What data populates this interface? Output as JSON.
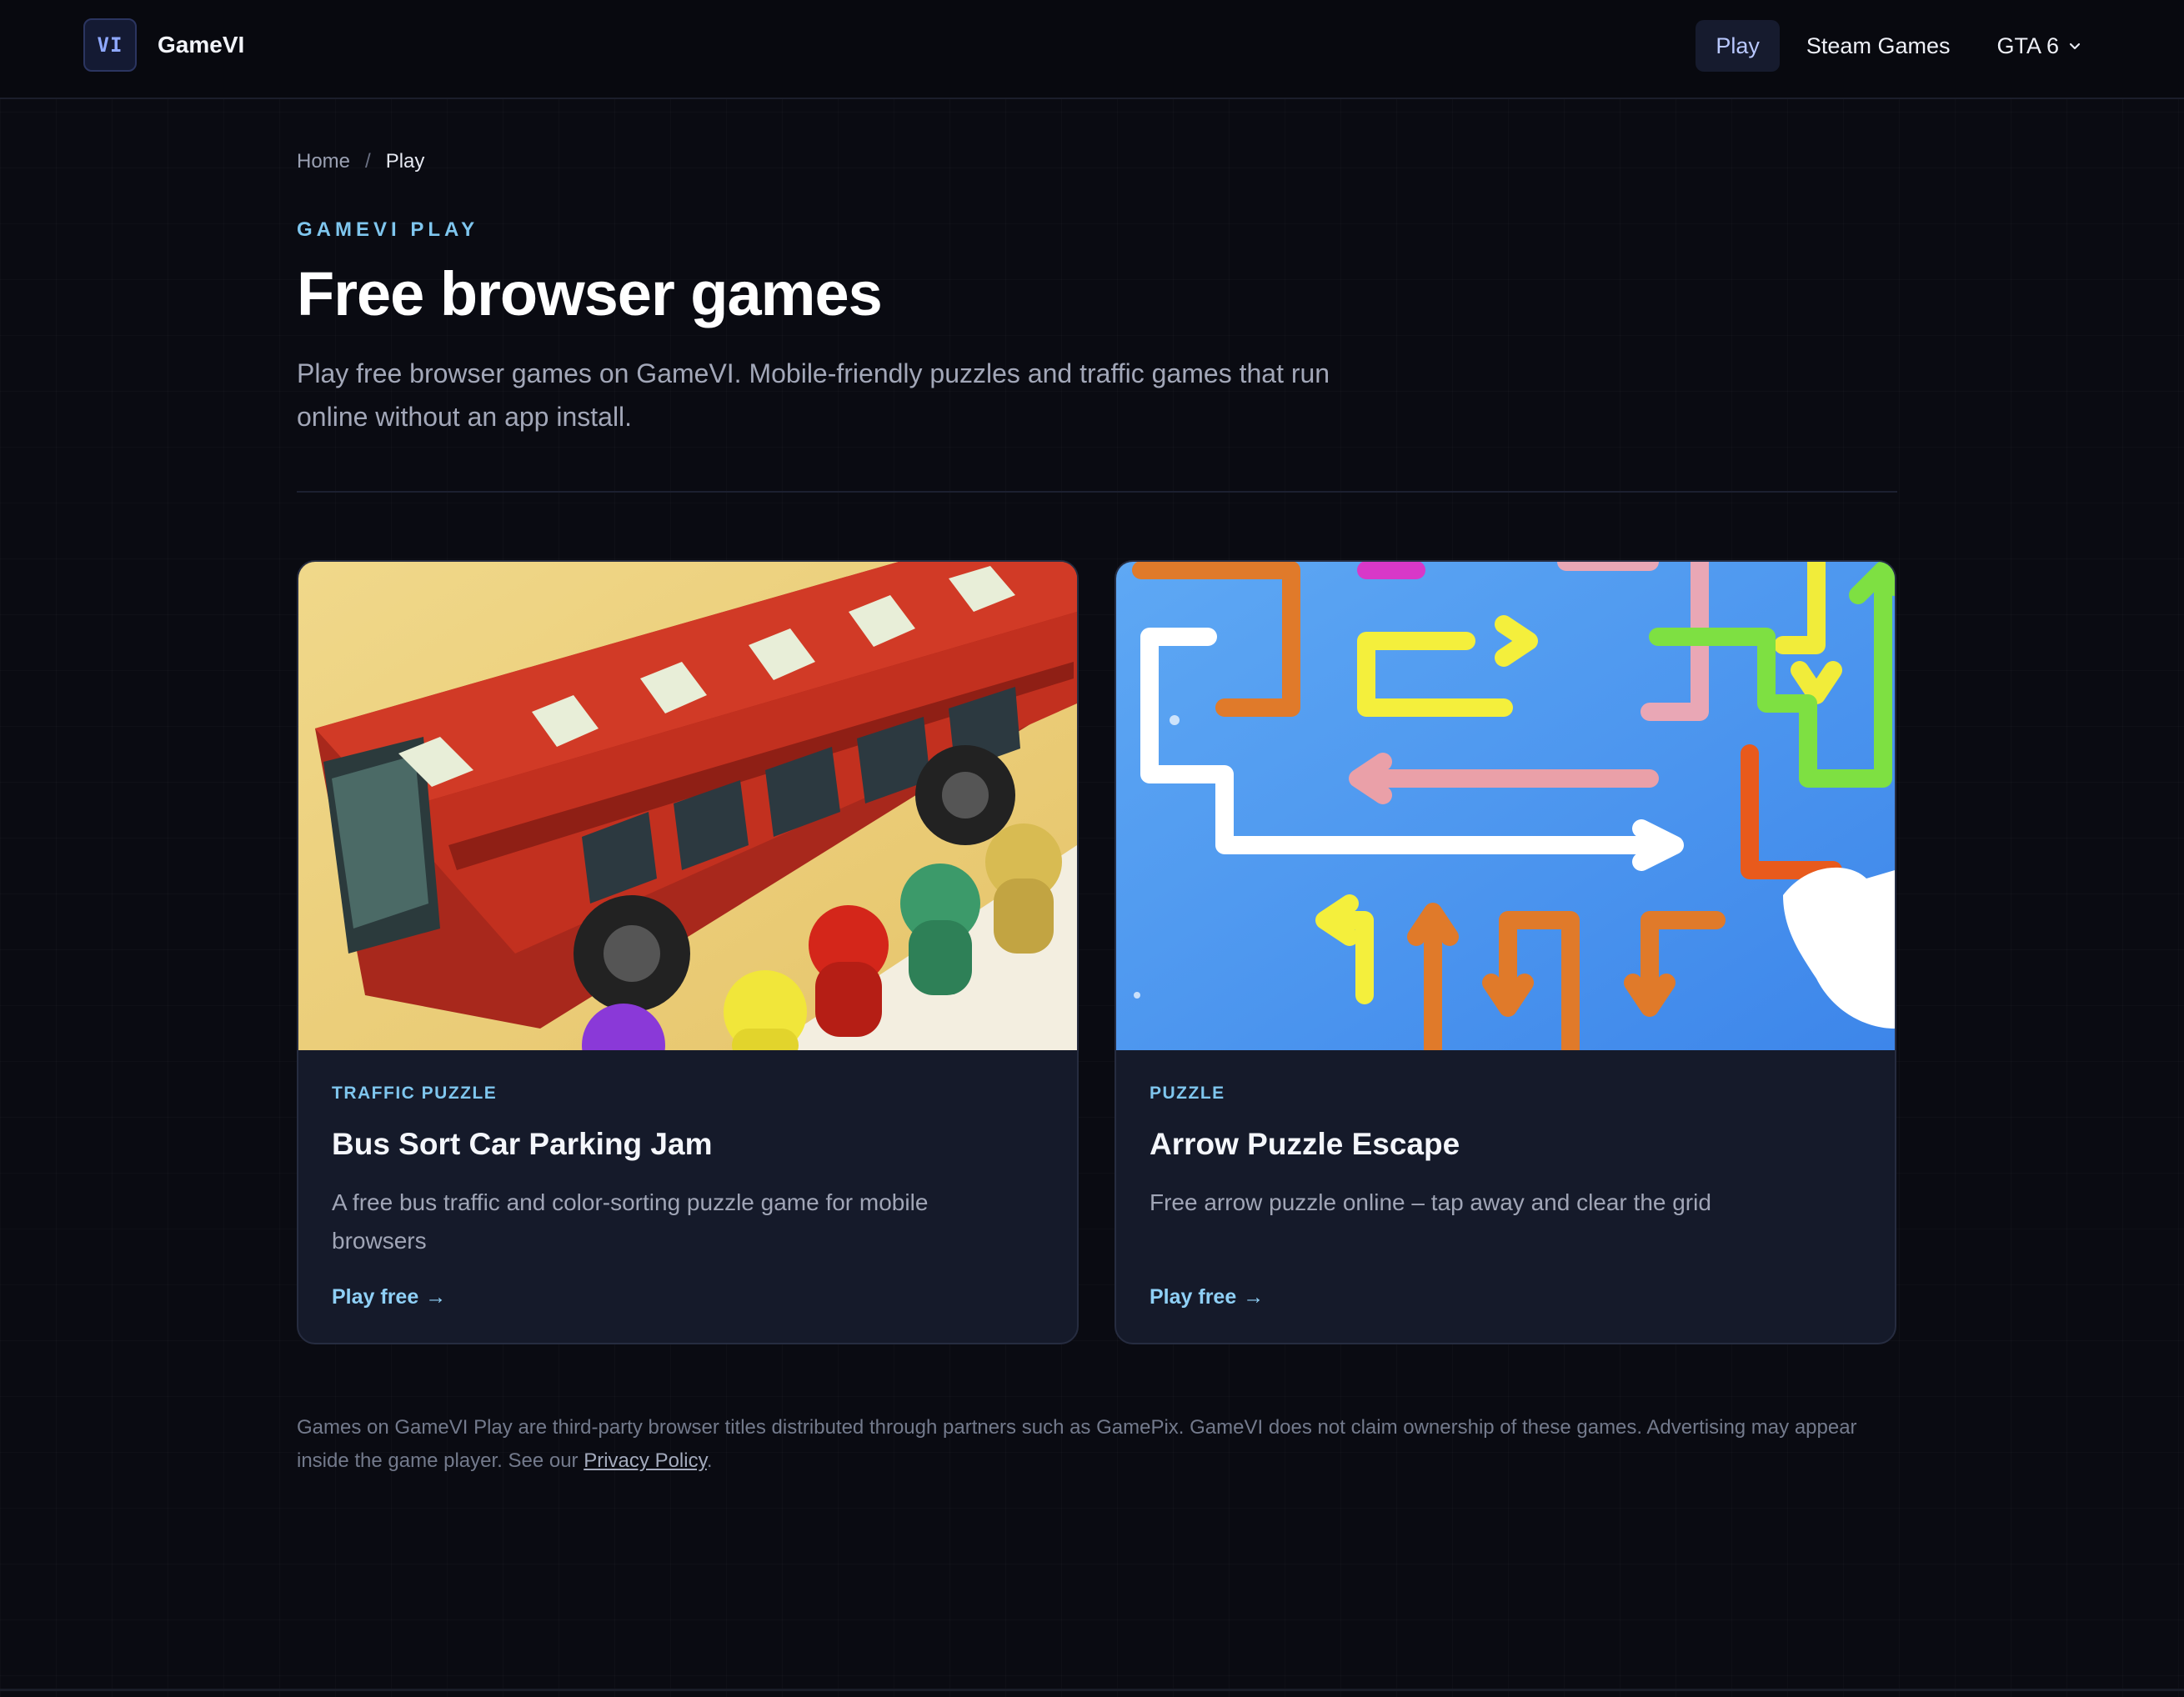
{
  "header": {
    "logo_text": "VI",
    "brand": "GameVI",
    "nav": [
      {
        "label": "Play",
        "active": true
      },
      {
        "label": "Steam Games",
        "active": false
      },
      {
        "label": "GTA 6",
        "active": false,
        "dropdown": true
      }
    ]
  },
  "breadcrumb": {
    "home": "Home",
    "separator": "/",
    "current": "Play"
  },
  "hero": {
    "eyebrow": "GAMEVI PLAY",
    "title": "Free browser games",
    "description": "Play free browser games on GameVI. Mobile-friendly puzzles and traffic games that run online without an app install."
  },
  "games": [
    {
      "category": "TRAFFIC PUZZLE",
      "title": "Bus Sort Car Parking Jam",
      "description": "A free bus traffic and color-sorting puzzle game for mobile browsers",
      "cta": "Play free",
      "cta_icon": "arrow-right-icon"
    },
    {
      "category": "PUZZLE",
      "title": "Arrow Puzzle Escape",
      "description": "Free arrow puzzle online – tap away and clear the grid",
      "cta": "Play free",
      "cta_icon": "arrow-right-icon"
    }
  ],
  "footnote": {
    "text": "Games on GameVI Play are third-party browser titles distributed through partners such as GamePix. GameVI does not claim ownership of these games. Advertising may appear inside the game player. See our ",
    "link": "Privacy Policy",
    "end": "."
  },
  "colors": {
    "background": "#0a0b12",
    "accent": "#7fc6ee",
    "card": "#151a2a",
    "nav_active_bg": "#161b2e"
  }
}
